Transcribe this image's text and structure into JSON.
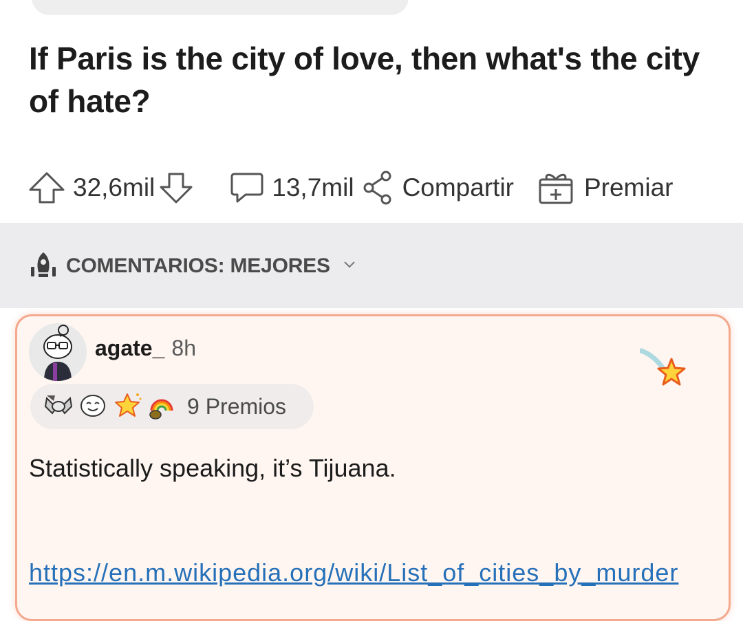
{
  "post": {
    "title": "If Paris is the city of love, then what's the city of hate?"
  },
  "actions": {
    "upvotes": "32,6mil",
    "comments": "13,7mil",
    "share_label": "Compartir",
    "award_label": "Premiar"
  },
  "sort": {
    "label": "COMENTARIOS: MEJORES"
  },
  "comment": {
    "username": "agate_",
    "time": "8h",
    "awards_count": "9 Premios",
    "text": "Statistically speaking, it’s Tijuana.",
    "link": "https://en.m.wikipedia.org/wiki/List_of_cities_by_murder"
  },
  "icons": {
    "upvote": "arrow-up-outline-icon",
    "downvote": "arrow-down-outline-icon",
    "comment": "speech-bubble-icon",
    "share": "share-nodes-icon",
    "award": "gift-box-icon",
    "sort": "rocket-icon",
    "sort_toggle": "chevron-down-icon",
    "favorite": "shooting-star-icon"
  },
  "colors": {
    "accent_border": "#f4a98e",
    "card_background": "#fff6f2",
    "link": "#2570b8",
    "star_orange": "#f5a623"
  }
}
